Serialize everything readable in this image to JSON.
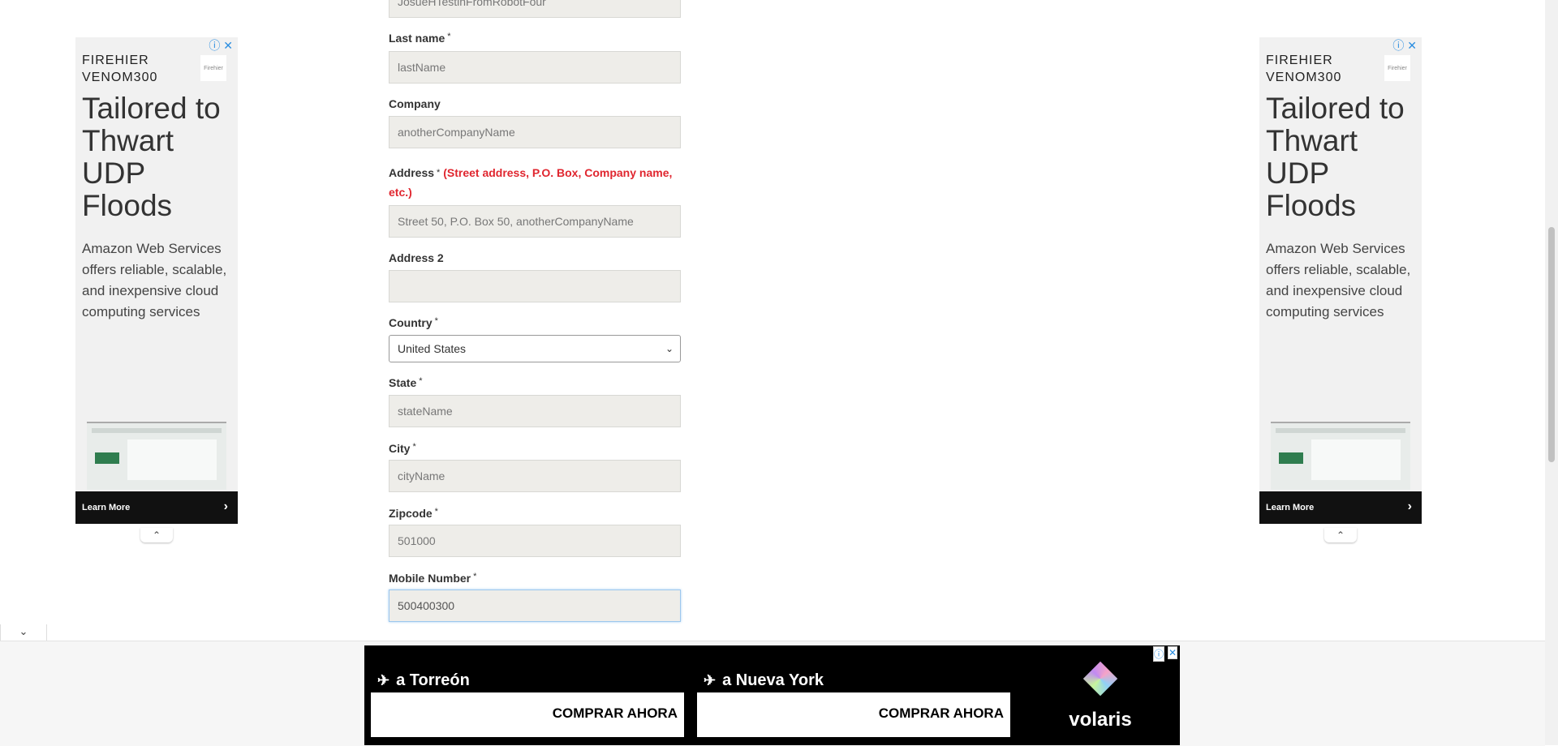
{
  "form": {
    "first_name_value": "JosueHTestinFromRobotFour",
    "last_name": {
      "label": "Last name",
      "required": "*",
      "value": "lastName"
    },
    "company": {
      "label": "Company",
      "value": "anotherCompanyName"
    },
    "address": {
      "label": "Address",
      "required": "*",
      "hint": "(Street address, P.O. Box, Company name, etc.)",
      "value": "Street 50, P.O. Box 50, anotherCompanyName"
    },
    "address2": {
      "label": "Address 2",
      "value": ""
    },
    "country": {
      "label": "Country",
      "required": "*",
      "selected": "United States"
    },
    "state": {
      "label": "State",
      "required": "*",
      "value": "stateName"
    },
    "city": {
      "label": "City",
      "required": "*",
      "value": "cityName"
    },
    "zipcode": {
      "label": "Zipcode",
      "required": "*",
      "value": "501000"
    },
    "mobile": {
      "label": "Mobile Number",
      "required": "*",
      "value": "500400300"
    }
  },
  "side_ad": {
    "brand_line1": "FIREHIER",
    "brand_line2": "VENOM300",
    "logo_text": "Firehier",
    "headline": "Tailored to Thwart UDP Floods",
    "body": "Amazon Web Services offers reliable, scalable, and inexpensive cloud computing services",
    "cta": "Learn More"
  },
  "bottom_ad": {
    "flight1": "a Torreón",
    "flight2": "a Nueva York",
    "button": "COMPRAR AHORA",
    "brand": "volaris"
  },
  "icons": {
    "adchoices": "ⓘ",
    "close": "✕",
    "chevron_up": "⌃",
    "chevron_down": "⌄",
    "arrow_right": "›",
    "plane": "✈"
  }
}
